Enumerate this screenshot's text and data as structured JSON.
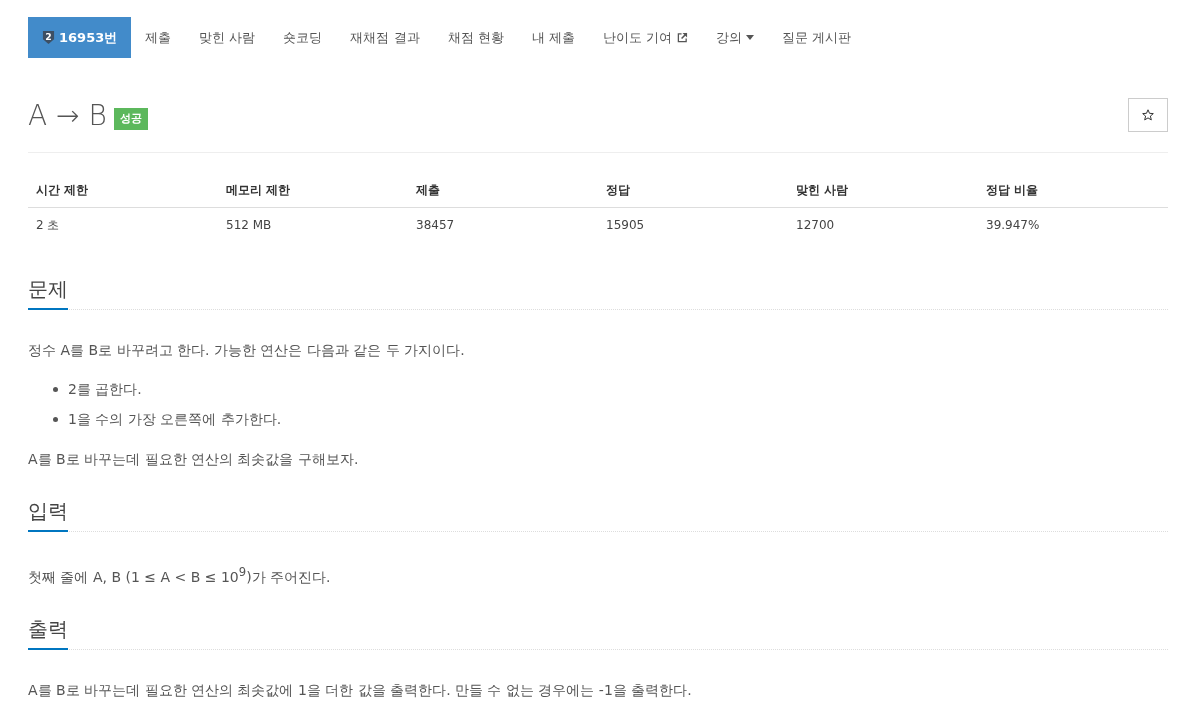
{
  "nav": {
    "items": [
      {
        "label": "16953번",
        "kind": "problem",
        "tier": "2",
        "selected": true
      },
      {
        "label": "제출",
        "kind": "link",
        "selected": false
      },
      {
        "label": "맞힌 사람",
        "kind": "link",
        "selected": false
      },
      {
        "label": "숏코딩",
        "kind": "link",
        "selected": false
      },
      {
        "label": "재채점 결과",
        "kind": "link",
        "selected": false
      },
      {
        "label": "채점 현황",
        "kind": "link",
        "selected": false
      },
      {
        "label": "내 제출",
        "kind": "link",
        "selected": false
      },
      {
        "label": "난이도 기여",
        "kind": "external",
        "selected": false
      },
      {
        "label": "강의",
        "kind": "dropdown",
        "selected": false
      },
      {
        "label": "질문 게시판",
        "kind": "link",
        "selected": false
      }
    ]
  },
  "problem": {
    "title": "A → B",
    "result_badge": "성공"
  },
  "info_table": {
    "columns": [
      "시간 제한",
      "메모리 제한",
      "제출",
      "정답",
      "맞힌 사람",
      "정답 비율"
    ],
    "rows": [
      [
        "2 초",
        "512 MB",
        "38457",
        "15905",
        "12700",
        "39.947%"
      ]
    ]
  },
  "sections": [
    {
      "heading": "문제",
      "blocks": [
        {
          "kind": "paragraph",
          "text": "정수 A를 B로 바꾸려고 한다. 가능한 연산은 다음과 같은 두 가지이다."
        },
        {
          "kind": "list",
          "items": [
            "2를 곱한다.",
            "1을 수의 가장 오른쪽에 추가한다."
          ]
        },
        {
          "kind": "paragraph",
          "text": "A를 B로 바꾸는데 필요한 연산의 최솟값을 구해보자."
        }
      ]
    },
    {
      "heading": "입력",
      "blocks": [
        {
          "kind": "paragraph",
          "text": "첫째 줄에 A, B (1 ≤ A < B ≤ 10$^{9}$)가 주어진다."
        }
      ]
    },
    {
      "heading": "출력",
      "blocks": [
        {
          "kind": "paragraph",
          "text": "A를 B로 바꾸는데 필요한 연산의 최솟값에 1을 더한 값을 출력한다. 만들 수 없는 경우에는 -1을 출력한다."
        }
      ]
    }
  ]
}
